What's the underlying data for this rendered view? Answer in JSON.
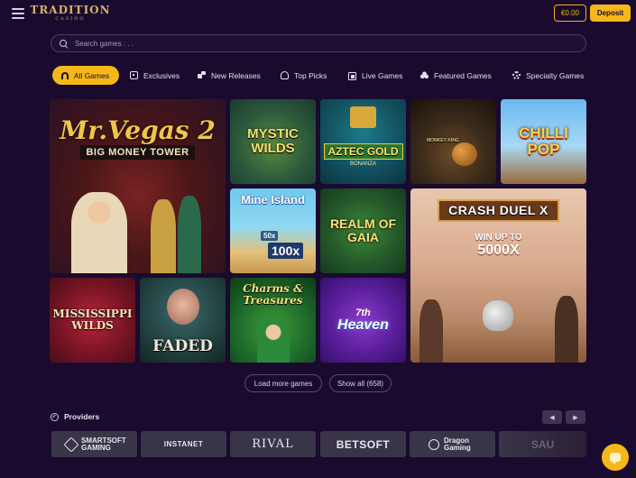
{
  "header": {
    "logo_main": "TRADITION",
    "logo_sub": "CASINO",
    "balance": "€0.00",
    "deposit_label": "Deposit"
  },
  "search": {
    "placeholder": "Search games . . ."
  },
  "tabs": [
    {
      "label": "All Games",
      "icon": "horseshoe-icon",
      "active": true
    },
    {
      "label": "Exclusives",
      "icon": "exclusive-icon"
    },
    {
      "label": "New Releases",
      "icon": "new-releases-icon"
    },
    {
      "label": "Top Picks",
      "icon": "trophy-icon"
    },
    {
      "label": "Live Games",
      "icon": "live-games-icon"
    },
    {
      "label": "Featured Games",
      "icon": "club-icon"
    },
    {
      "label": "Specialty Games",
      "icon": "gear-icon"
    }
  ],
  "games": {
    "mr_vegas": {
      "title": "Mr.Vegas 2",
      "sub": "BIG MONEY TOWER"
    },
    "mystic_wilds": {
      "title": "MYSTIC WILDS"
    },
    "aztec_gold": {
      "title": "AZTEC GOLD",
      "sub": "BONANZA"
    },
    "monkey_king": {
      "title": "MONKEY KING"
    },
    "chilli_pop": {
      "title": "CHILLI POP"
    },
    "mine_island": {
      "title": "Mine Island",
      "m1": "50x",
      "m2": "100x"
    },
    "realm_of_gaia": {
      "title": "REALM OF GAIA"
    },
    "crash_duel": {
      "title": "CRASH DUEL X",
      "sub": "WIN UP TO",
      "big": "5000X"
    },
    "mississippi": {
      "title": "MISSISSIPPI WILDS"
    },
    "faded": {
      "title": "FADED"
    },
    "charms": {
      "title": "Charms & Treasures"
    },
    "heaven": {
      "sup": "7th",
      "title": "Heaven"
    }
  },
  "actions": {
    "load_more": "Load more games",
    "show_all": "Show all (658)"
  },
  "providers": {
    "heading": "Providers",
    "prev": "◀",
    "next": "▶",
    "items": [
      "SMARTSOFT GAMING",
      "INSTANET",
      "RIVAL",
      "BETSOFT",
      "Dragon Gaming",
      "SAU"
    ]
  },
  "colors": {
    "background": "#1a0b2e",
    "accent": "#f5b71a",
    "tile_border": "#4b3a66"
  }
}
